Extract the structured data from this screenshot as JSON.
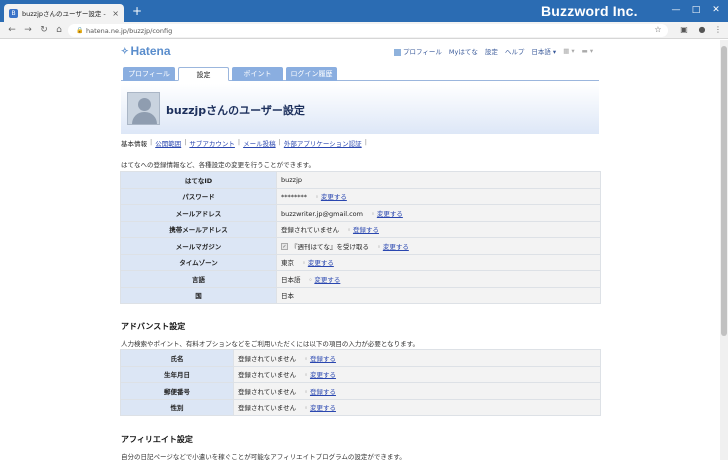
{
  "browser": {
    "tab_title": "buzzjpさんのユーザー設定 - はてな",
    "tab_close": "×",
    "new_tab": "+",
    "brand": "Buzzword Inc.",
    "url": "hatena.ne.jp/buzzjp/config",
    "back": "←",
    "forward": "→",
    "reload": "↻",
    "home": "⌂",
    "minimize": "—",
    "maximize": "□",
    "close": "✕"
  },
  "site": {
    "logo": "Hatena",
    "nav": [
      "プロフィール",
      "Myはてな",
      "設定",
      "ヘルプ",
      "日本語"
    ]
  },
  "tabs": [
    {
      "label": "プロフィール",
      "active": false
    },
    {
      "label": "設定",
      "active": true
    },
    {
      "label": "ポイント",
      "active": false
    },
    {
      "label": "ログイン履歴",
      "active": false
    }
  ],
  "header": {
    "title": "buzzjpさんのユーザー設定"
  },
  "subnav": {
    "current": "基本情報",
    "links": [
      "公開範囲",
      "サブアカウント",
      "メール投稿",
      "外部アプリケーション認証"
    ]
  },
  "basic": {
    "intro": "はてなへの登録情報など、各種設定の変更を行うことができます。",
    "rows": [
      {
        "label": "はてなID",
        "value": "buzzjp",
        "link": ""
      },
      {
        "label": "パスワード",
        "value": "********",
        "link": "変更する"
      },
      {
        "label": "メールアドレス",
        "value": "buzzwriter.jp@gmail.com",
        "link": "変更する"
      },
      {
        "label": "携帯メールアドレス",
        "value": "登録されていません",
        "link": "登録する"
      },
      {
        "label": "メールマガジン",
        "value": "『週刊はてな』を受け取る",
        "link": "変更する",
        "checkbox": true
      },
      {
        "label": "タイムゾーン",
        "value": "東京",
        "link": "変更する"
      },
      {
        "label": "言語",
        "value": "日本語",
        "link": "変更する"
      },
      {
        "label": "国",
        "value": "日本",
        "link": ""
      }
    ]
  },
  "advanced": {
    "title": "アドバンスト設定",
    "desc": "人力検索やポイント、有料オプションなどをご利用いただくには以下の項目の入力が必要となります。",
    "rows": [
      {
        "label": "氏名",
        "value": "登録されていません",
        "link": "登録する"
      },
      {
        "label": "生年月日",
        "value": "登録されていません",
        "link": "変更する"
      },
      {
        "label": "郵便番号",
        "value": "登録されていません",
        "link": "登録する"
      },
      {
        "label": "性別",
        "value": "登録されていません",
        "link": "変更する"
      }
    ]
  },
  "affiliate": {
    "title": "アフィリエイト設定",
    "desc": "自分の日記ページなどで小遣いを稼ぐことが可能なアフィリエイトプログラムの設定ができます。"
  }
}
